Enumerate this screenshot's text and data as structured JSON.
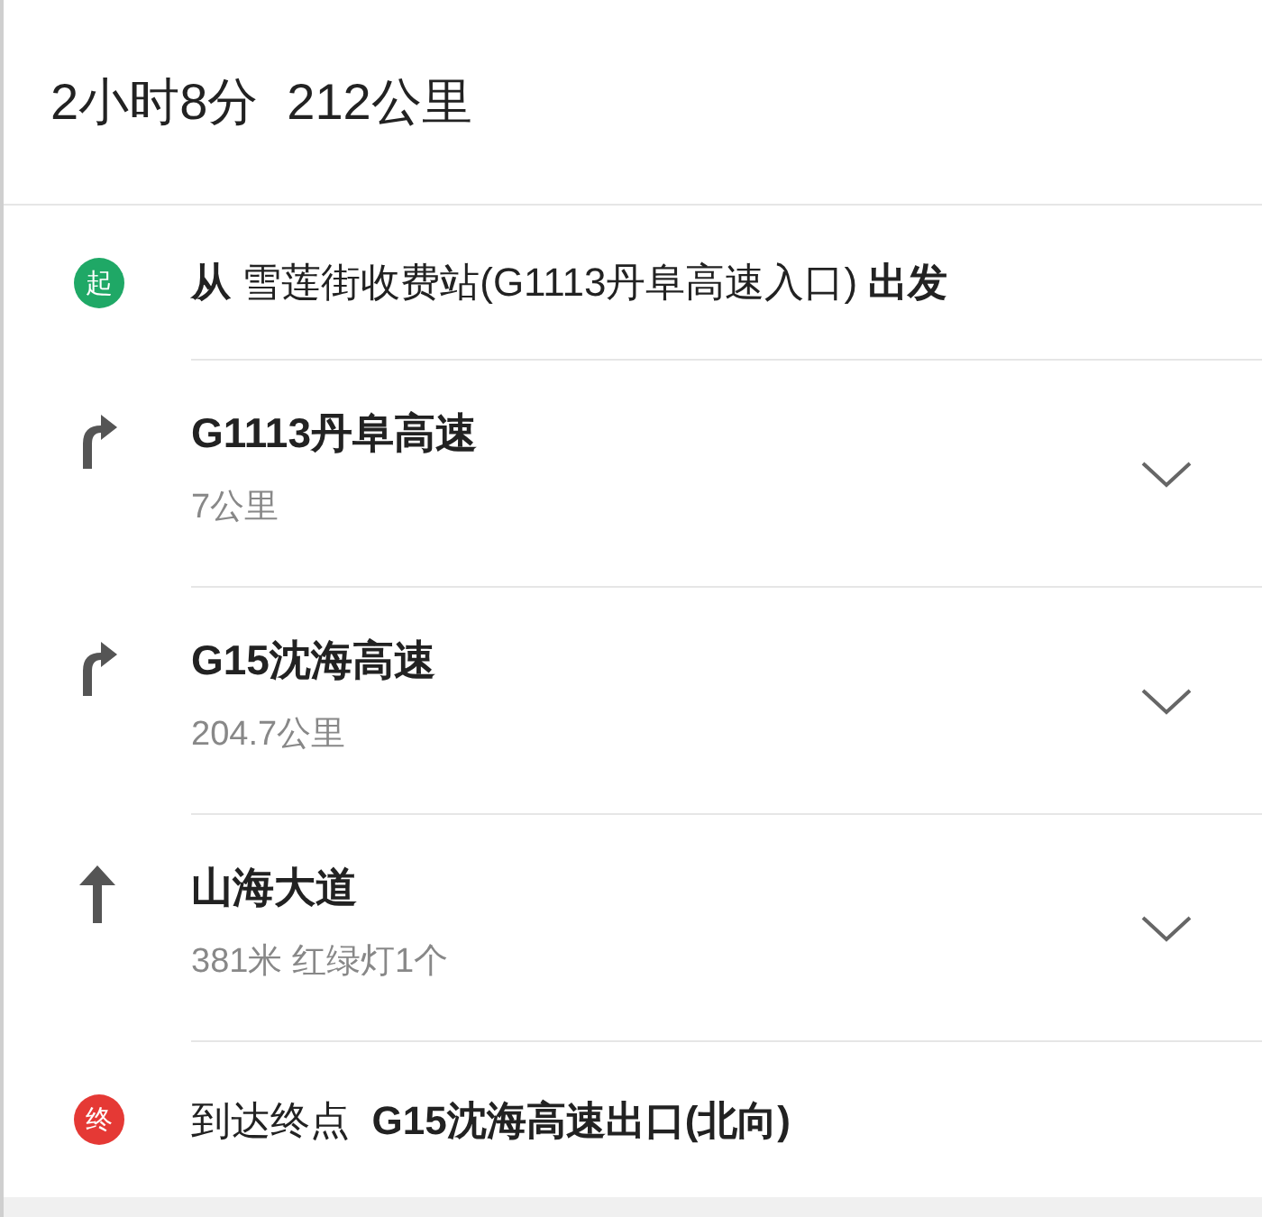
{
  "summary": {
    "duration": "2小时8分",
    "distance": "212公里"
  },
  "start": {
    "badge": "起",
    "color": "#1fa866",
    "text": "**从** 雪莲街收费站(G1113丹阜高速入口) **出发**"
  },
  "steps": [
    {
      "kind": "turn-right",
      "road": "G1113丹阜高速",
      "detail": "7公里",
      "expanded": false
    },
    {
      "kind": "turn-right",
      "road": "G15沈海高速",
      "detail": "204.7公里",
      "expanded": false
    },
    {
      "kind": "straight",
      "road": "山海大道",
      "detail": "381米 红绿灯1个",
      "expanded": false
    }
  ],
  "end": {
    "badge": "终",
    "color": "#e53935",
    "text": "到达终点  **G15沈海高速出口(北向)**"
  }
}
